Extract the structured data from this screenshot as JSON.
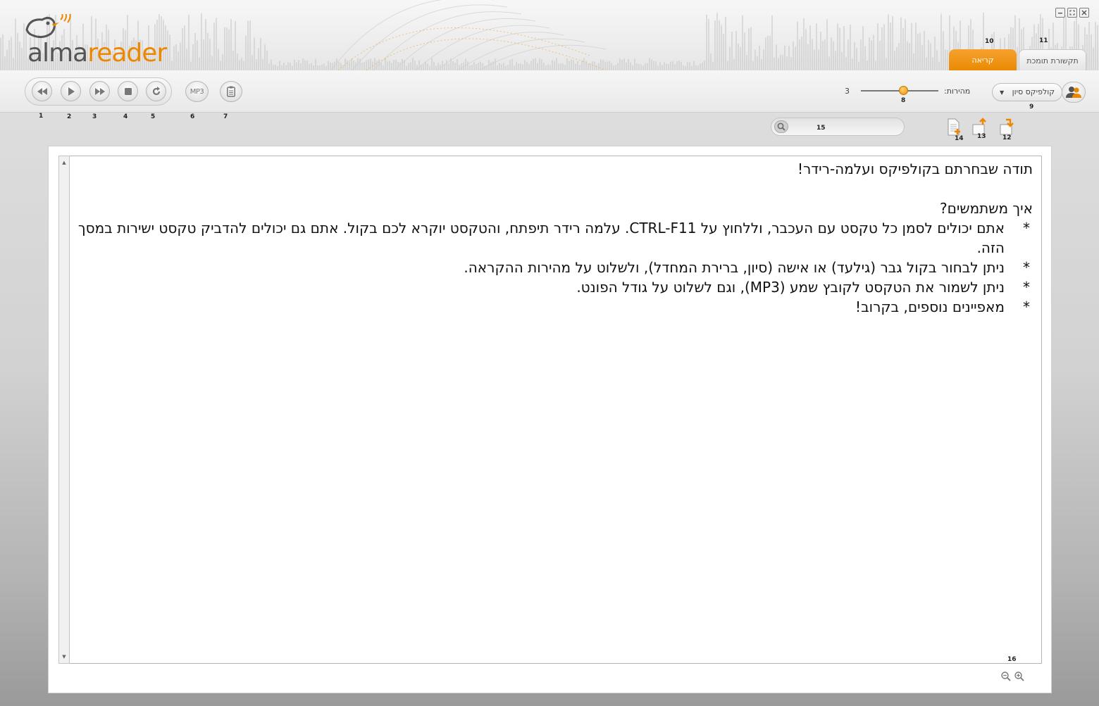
{
  "app": {
    "logo_part1": "alma",
    "logo_part2": "reader",
    "window_controls": [
      "minimize",
      "maximize",
      "close"
    ]
  },
  "tabs": {
    "read": "קריאה",
    "support": "תקשורת תומכת"
  },
  "callouts": {
    "n1": "1",
    "n2": "2",
    "n3": "3",
    "n4": "4",
    "n5": "5",
    "n6": "6",
    "n7": "7",
    "n8": "8",
    "n9": "9",
    "n10": "10",
    "n11": "11",
    "n12": "12",
    "n13": "13",
    "n14": "14",
    "n15": "15",
    "n16": "16"
  },
  "player": {
    "buttons": [
      "rewind-icon",
      "play-icon",
      "fast-forward-icon",
      "stop-icon",
      "repeat-icon"
    ],
    "mp3_label": "MP3",
    "clipboard": "clipboard-icon"
  },
  "voice": {
    "selected": "קולפיקס סיון"
  },
  "speed": {
    "label": "מהירות:",
    "value": "3",
    "level": 0.55
  },
  "search": {
    "placeholder": ""
  },
  "content": {
    "title": "תודה שבחרתם בקולפיקס ועלמה-רידר!",
    "question": "איך משתמשים?",
    "bullets": [
      "אתם יכולים לסמן כל טקסט עם העכבר, וללחוץ על CTRL-F11. עלמה רידר תיפתח, והטקסט יוקרא לכם בקול. אתם גם יכולים להדביק טקסט ישירות במסך הזה.",
      "ניתן לבחור בקול גבר (גילעד) או אישה (סיון, ברירת המחדל), ולשלוט על מהירות ההקראה.",
      "ניתן לשמור את הטקסט לקובץ שמע (MP3), וגם לשלוט על גודל הפונט.",
      "מאפיינים נוספים, בקרוב!"
    ],
    "bullet_mark": "*"
  },
  "colors": {
    "accent": "#ee8700",
    "logo_gray": "#555555"
  }
}
